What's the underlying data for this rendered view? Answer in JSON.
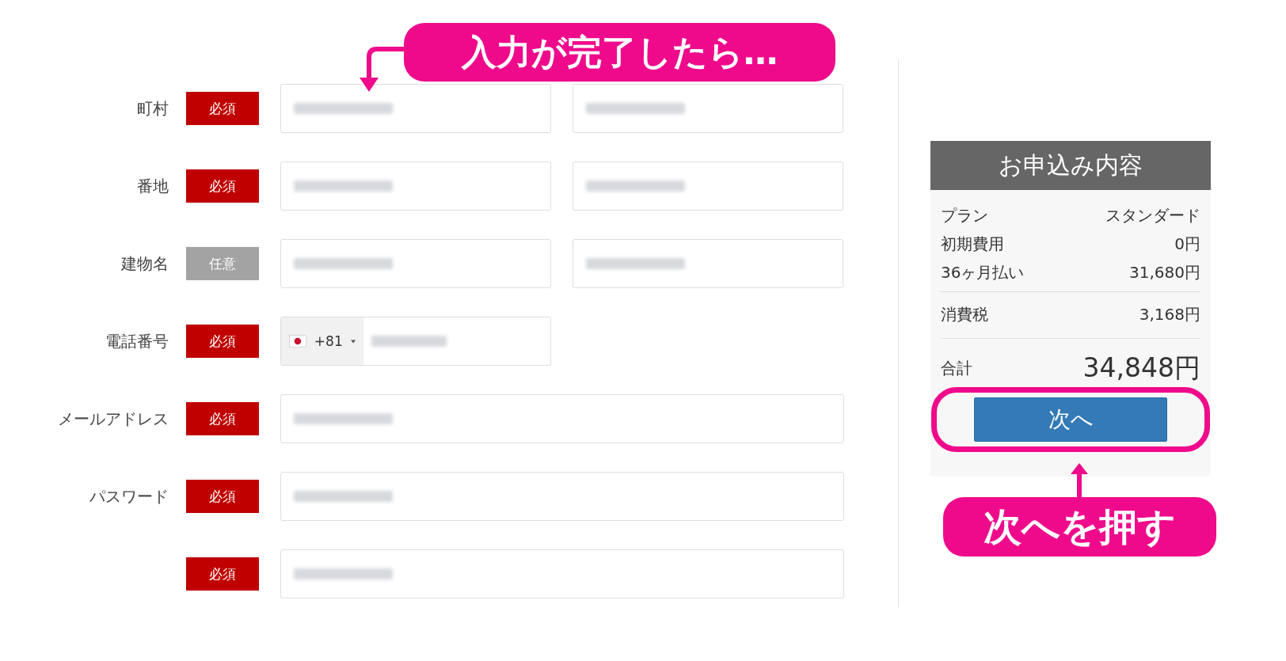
{
  "form": {
    "rows": [
      {
        "label": "町村",
        "badge": "必須",
        "required": true,
        "kind": "pair"
      },
      {
        "label": "番地",
        "badge": "必須",
        "required": true,
        "kind": "pair"
      },
      {
        "label": "建物名",
        "badge": "任意",
        "required": false,
        "kind": "pair"
      },
      {
        "label": "電話番号",
        "badge": "必須",
        "required": true,
        "kind": "phone",
        "dial_code": "+81"
      },
      {
        "label": "メールアドレス",
        "badge": "必須",
        "required": true,
        "kind": "wide"
      },
      {
        "label": "パスワード",
        "badge": "必須",
        "required": true,
        "kind": "wide"
      },
      {
        "label": "",
        "badge": "必須",
        "required": true,
        "kind": "wide"
      }
    ]
  },
  "summary": {
    "title": "お申込み内容",
    "groups": [
      [
        {
          "label": "プラン",
          "value": "スタンダード"
        },
        {
          "label": "初期費用",
          "value": "0円"
        },
        {
          "label": "36ヶ月払い",
          "value": "31,680円"
        }
      ],
      [
        {
          "label": "消費税",
          "value": "3,168円"
        }
      ]
    ],
    "total": {
      "label": "合計",
      "value": "34,848円"
    },
    "button": "次へ"
  },
  "annotations": {
    "top_callout": "入力が完了したら…",
    "bottom_callout": "次へを押す"
  }
}
